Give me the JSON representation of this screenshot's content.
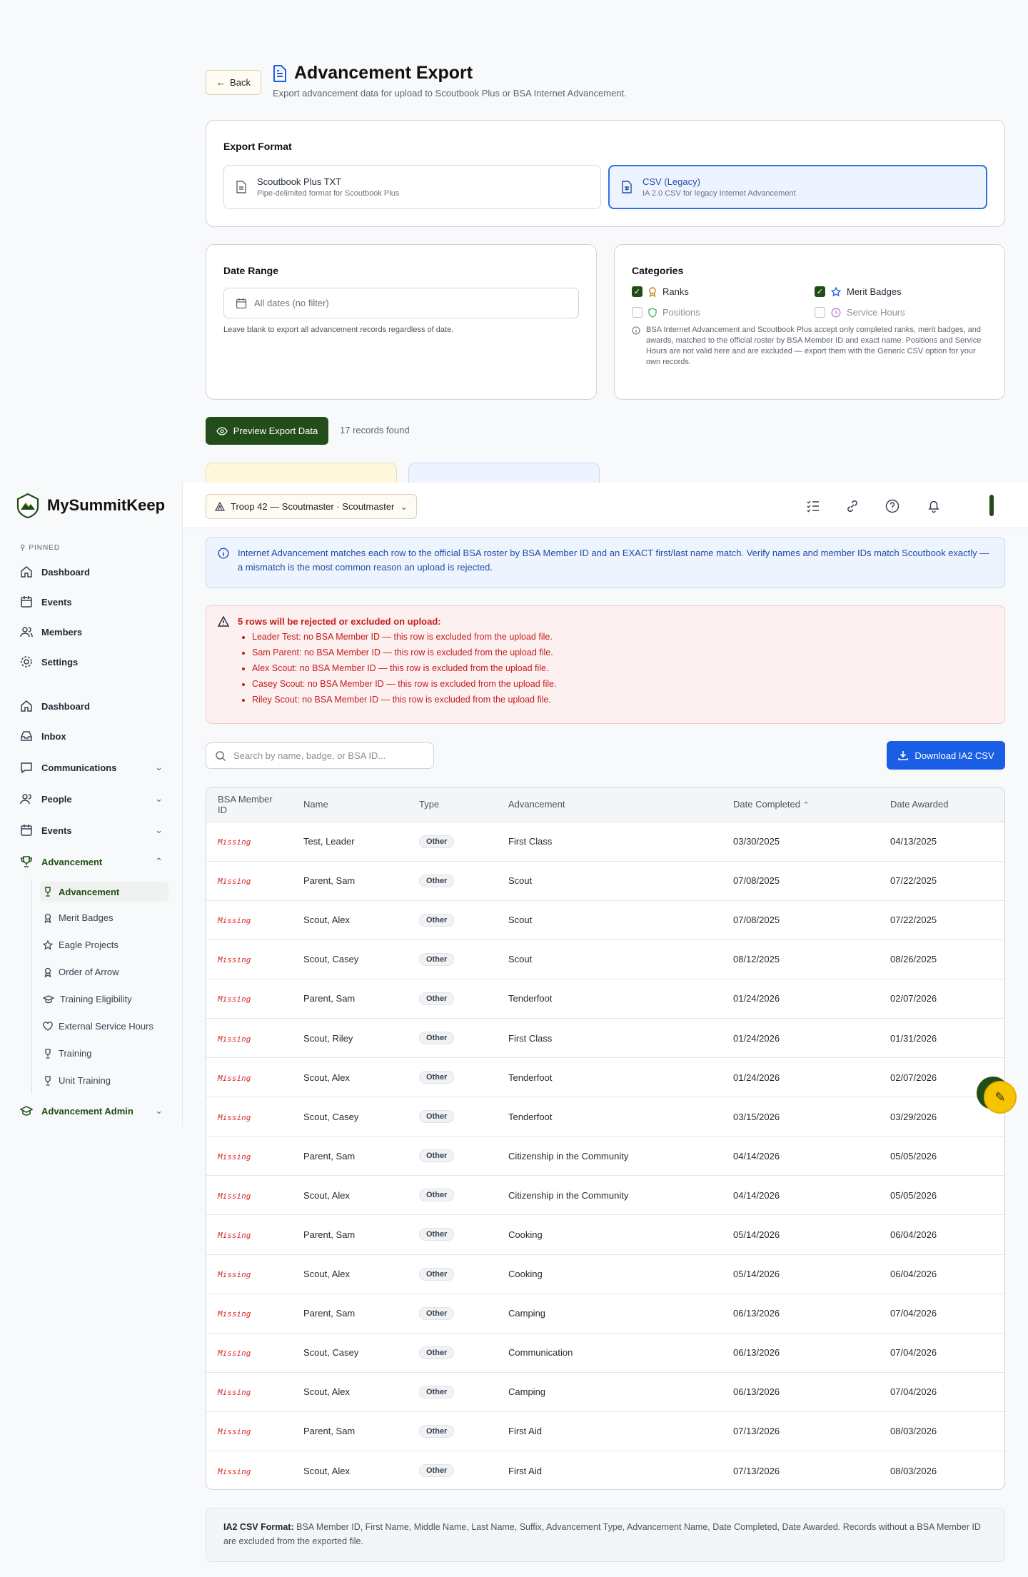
{
  "back_label": "Back",
  "page": {
    "title": "Advancement Export",
    "subtitle": "Export advancement data for upload to Scoutbook Plus or BSA Internet Advancement."
  },
  "export_format": {
    "heading": "Export Format",
    "options": [
      {
        "title": "Scoutbook Plus TXT",
        "desc": "Pipe-delimited format for Scoutbook Plus",
        "selected": false
      },
      {
        "title": "CSV (Legacy)",
        "desc": "IA 2.0 CSV for legacy Internet Advancement",
        "selected": true
      }
    ]
  },
  "date_range": {
    "heading": "Date Range",
    "placeholder": "All dates (no filter)",
    "help": "Leave blank to export all advancement records regardless of date."
  },
  "categories": {
    "heading": "Categories",
    "items": [
      {
        "label": "Ranks",
        "checked": true,
        "icon": "rank-icon"
      },
      {
        "label": "Merit Badges",
        "checked": true,
        "icon": "star-icon"
      },
      {
        "label": "Positions",
        "checked": false,
        "icon": "shield-icon"
      },
      {
        "label": "Service Hours",
        "checked": false,
        "icon": "clock-icon"
      }
    ],
    "note": "BSA Internet Advancement and Scoutbook Plus accept only completed ranks, merit badges, and awards, matched to the official roster by BSA Member ID and exact name. Positions and Service Hours are not valid here and are excluded — export them with the Generic CSV option for your own records."
  },
  "preview_label": "Preview Export Data",
  "records_found": "17 records found",
  "brand": "MySummitKeep",
  "sidebar": {
    "pinned_label": "PINNED",
    "pinned": [
      {
        "label": "Dashboard",
        "icon": "home-icon"
      },
      {
        "label": "Events",
        "icon": "calendar-icon"
      },
      {
        "label": "Members",
        "icon": "users-icon"
      },
      {
        "label": "Settings",
        "icon": "gear-icon"
      }
    ],
    "main": [
      {
        "label": "Dashboard",
        "icon": "home-icon",
        "chevron": false
      },
      {
        "label": "Inbox",
        "icon": "inbox-icon",
        "chevron": false
      },
      {
        "label": "Communications",
        "icon": "chat-icon",
        "chevron": true
      },
      {
        "label": "People",
        "icon": "users-icon",
        "chevron": true
      },
      {
        "label": "Events",
        "icon": "calendar-icon",
        "chevron": true
      },
      {
        "label": "Advancement",
        "icon": "trophy-icon",
        "chevron": true
      }
    ],
    "sub": [
      {
        "label": "Advancement",
        "icon": "trophy-icon",
        "active": true
      },
      {
        "label": "Merit Badges",
        "icon": "medal-icon",
        "active": false
      },
      {
        "label": "Eagle Projects",
        "icon": "star-icon",
        "active": false
      },
      {
        "label": "Order of Arrow",
        "icon": "medal-icon",
        "active": false
      },
      {
        "label": "Training Eligibility",
        "icon": "grad-cap-icon",
        "active": false
      },
      {
        "label": "External Service Hours",
        "icon": "heart-icon",
        "active": false
      },
      {
        "label": "Training",
        "icon": "trophy-icon",
        "active": false
      },
      {
        "label": "Unit Training",
        "icon": "trophy-icon",
        "active": false
      }
    ],
    "admin": {
      "label": "Advancement Admin",
      "icon": "grad-cap-icon"
    }
  },
  "header": {
    "troop_label": "Troop 42 — Scoutmaster · Scoutmaster"
  },
  "info_text": "Internet Advancement matches each row to the official BSA roster by BSA Member ID and an EXACT first/last name match. Verify names and member IDs match Scoutbook exactly — a mismatch is the most common reason an upload is rejected.",
  "warning": {
    "title": "5 rows will be rejected or excluded on upload:",
    "items": [
      "Leader Test: no BSA Member ID — this row is excluded from the upload file.",
      "Sam Parent: no BSA Member ID — this row is excluded from the upload file.",
      "Alex Scout: no BSA Member ID — this row is excluded from the upload file.",
      "Casey Scout: no BSA Member ID — this row is excluded from the upload file.",
      "Riley Scout: no BSA Member ID — this row is excluded from the upload file."
    ]
  },
  "search_placeholder": "Search by name, badge, or BSA ID...",
  "download_label": "Download IA2 CSV",
  "table": {
    "columns": [
      "BSA Member ID",
      "Name",
      "Type",
      "Advancement",
      "Date Completed",
      "Date Awarded"
    ],
    "sort_indicator": "⌃",
    "rows": [
      [
        "Missing",
        "Test, Leader",
        "Other",
        "First Class",
        "03/30/2025",
        "04/13/2025"
      ],
      [
        "Missing",
        "Parent, Sam",
        "Other",
        "Scout",
        "07/08/2025",
        "07/22/2025"
      ],
      [
        "Missing",
        "Scout, Alex",
        "Other",
        "Scout",
        "07/08/2025",
        "07/22/2025"
      ],
      [
        "Missing",
        "Scout, Casey",
        "Other",
        "Scout",
        "08/12/2025",
        "08/26/2025"
      ],
      [
        "Missing",
        "Parent, Sam",
        "Other",
        "Tenderfoot",
        "01/24/2026",
        "02/07/2026"
      ],
      [
        "Missing",
        "Scout, Riley",
        "Other",
        "First Class",
        "01/24/2026",
        "01/31/2026"
      ],
      [
        "Missing",
        "Scout, Alex",
        "Other",
        "Tenderfoot",
        "01/24/2026",
        "02/07/2026"
      ],
      [
        "Missing",
        "Scout, Casey",
        "Other",
        "Tenderfoot",
        "03/15/2026",
        "03/29/2026"
      ],
      [
        "Missing",
        "Parent, Sam",
        "Other",
        "Citizenship in the Community",
        "04/14/2026",
        "05/05/2026"
      ],
      [
        "Missing",
        "Scout, Alex",
        "Other",
        "Citizenship in the Community",
        "04/14/2026",
        "05/05/2026"
      ],
      [
        "Missing",
        "Parent, Sam",
        "Other",
        "Cooking",
        "05/14/2026",
        "06/04/2026"
      ],
      [
        "Missing",
        "Scout, Alex",
        "Other",
        "Cooking",
        "05/14/2026",
        "06/04/2026"
      ],
      [
        "Missing",
        "Parent, Sam",
        "Other",
        "Camping",
        "06/13/2026",
        "07/04/2026"
      ],
      [
        "Missing",
        "Scout, Casey",
        "Other",
        "Communication",
        "06/13/2026",
        "07/04/2026"
      ],
      [
        "Missing",
        "Scout, Alex",
        "Other",
        "Camping",
        "06/13/2026",
        "07/04/2026"
      ],
      [
        "Missing",
        "Parent, Sam",
        "Other",
        "First Aid",
        "07/13/2026",
        "08/03/2026"
      ],
      [
        "Missing",
        "Scout, Alex",
        "Other",
        "First Aid",
        "07/13/2026",
        "08/03/2026"
      ]
    ]
  },
  "ia2_note": {
    "label": "IA2 CSV Format:",
    "text": " BSA Member ID, First Name, Middle Name, Last Name, Suffix, Advancement Type, Advancement Name, Date Completed, Date Awarded. Records without a BSA Member ID are excluded from the exported file."
  },
  "colors": {
    "brand_green": "#224d18",
    "accent_blue": "#1a5ee6",
    "error_red": "#c41d1d"
  }
}
